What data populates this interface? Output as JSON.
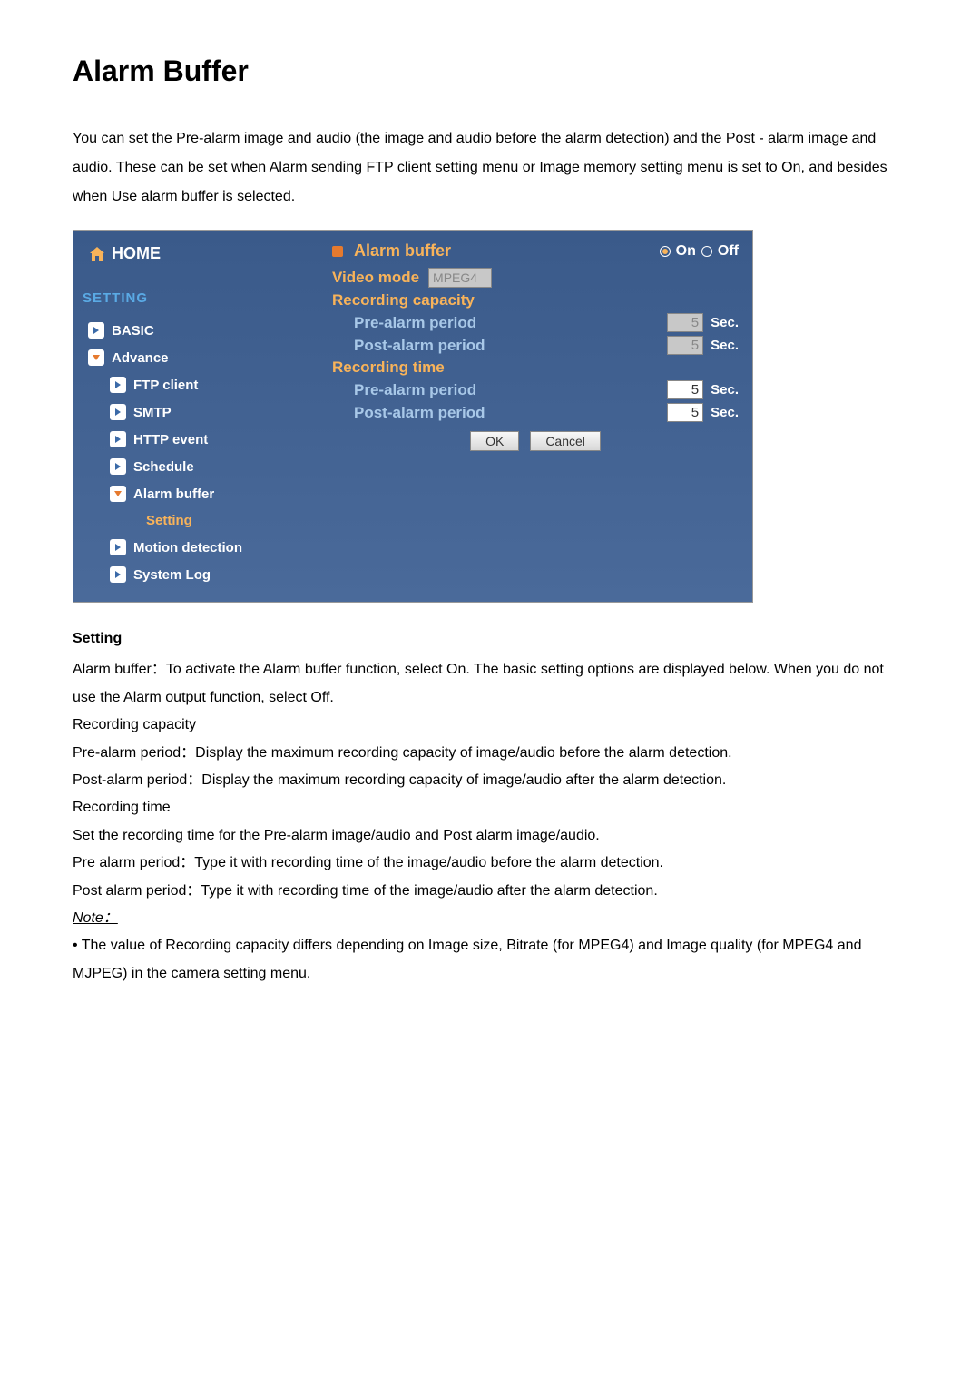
{
  "page_title": "Alarm Buffer",
  "intro": "You can set the Pre-alarm image and audio (the image and audio before the alarm detection) and the Post - alarm image and audio. These can be set when Alarm sending FTP client setting menu or Image memory setting menu is set to On, and besides when Use alarm buffer is selected.",
  "sidebar": {
    "home": "HOME",
    "setting_header": "SETTING",
    "items": {
      "basic": "BASIC",
      "advance": "Advance",
      "ftp": "FTP client",
      "smtp": "SMTP",
      "http": "HTTP event",
      "schedule": "Schedule",
      "alarm_buffer": "Alarm buffer",
      "alarm_setting": "Setting",
      "motion": "Motion detection",
      "syslog": "System Log"
    }
  },
  "panel": {
    "title": "Alarm buffer",
    "radio_on": "On",
    "radio_off": "Off",
    "video_mode_label": "Video mode",
    "video_mode_value": "MPEG4",
    "recording_capacity": "Recording capacity",
    "recording_time": "Recording time",
    "pre_label": "Pre-alarm period",
    "post_label": "Post-alarm period",
    "cap_pre_value": "5",
    "cap_post_value": "5",
    "time_pre_value": "5",
    "time_post_value": "5",
    "unit": "Sec.",
    "ok": "OK",
    "cancel": "Cancel"
  },
  "desc": {
    "heading": "Setting",
    "p1": "Alarm buffer：To activate the Alarm buffer function, select On. The basic setting options are displayed below. When you do not use the Alarm output function, select Off.",
    "p2": "Recording capacity",
    "p3": "Pre-alarm period：Display the maximum recording capacity of image/audio before the alarm detection.",
    "p4": "Post-alarm period：Display the maximum recording capacity of image/audio after the alarm detection.",
    "p5": "Recording time",
    "p6": "Set the recording time for the Pre-alarm image/audio and Post alarm image/audio.",
    "p7": "Pre alarm period：Type it with recording time of the image/audio before the alarm detection.",
    "p8": "Post alarm period：Type it with recording time of the image/audio after the alarm detection.",
    "note_label": "Note：",
    "note1": "• The value of Recording capacity differs depending on Image size, Bitrate (for MPEG4) and Image quality (for MPEG4 and MJPEG) in the camera setting menu."
  }
}
